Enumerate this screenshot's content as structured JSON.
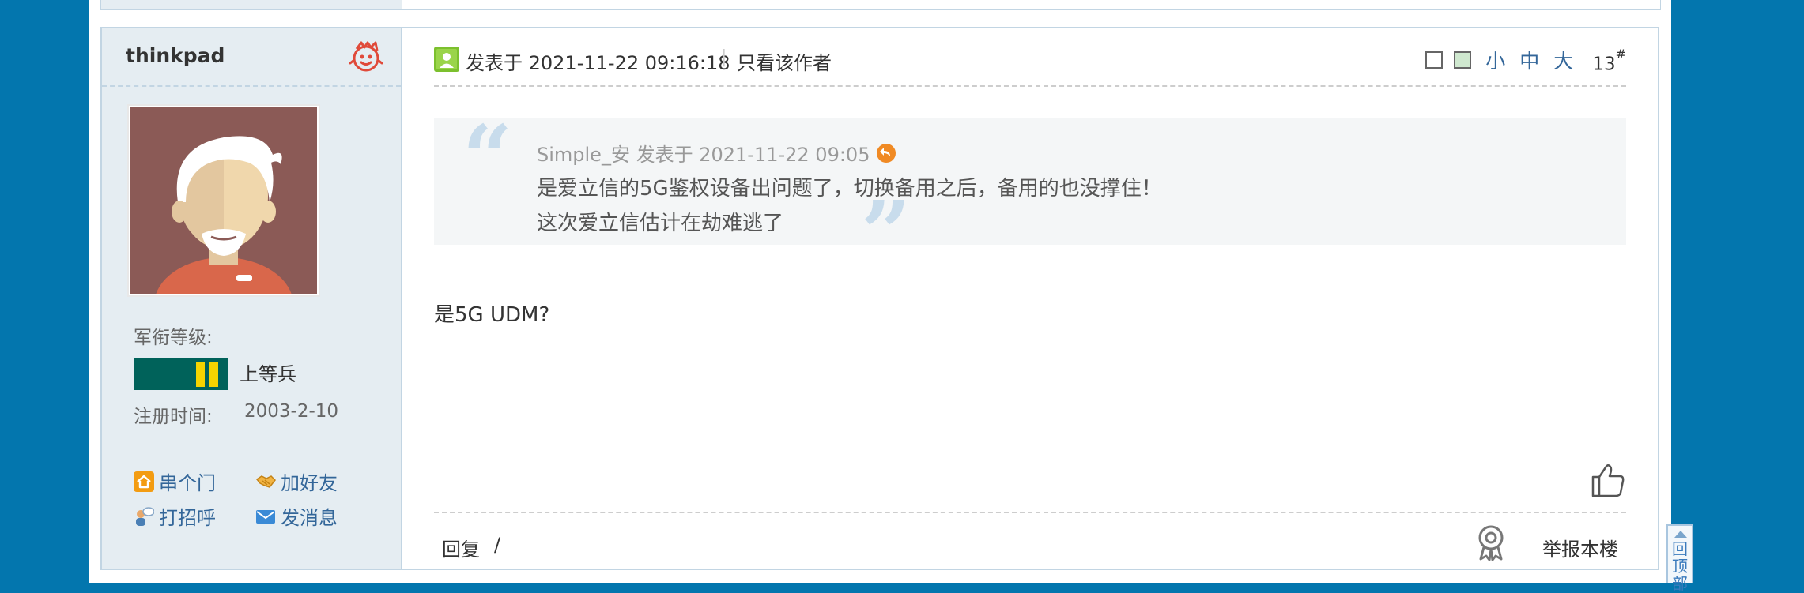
{
  "author": {
    "username": "thinkpad",
    "rank_label": "军衔等级:",
    "rank_name": "上等兵",
    "reg_label": "注册时间:",
    "reg_value": "2003-2-10",
    "links": [
      {
        "label": "串个门",
        "icon": "home-icon"
      },
      {
        "label": "加好友",
        "icon": "handshake-icon"
      },
      {
        "label": "打招呼",
        "icon": "greet-icon"
      },
      {
        "label": "发消息",
        "icon": "mail-icon"
      }
    ]
  },
  "post": {
    "time": "发表于 2021-11-22 09:16:18",
    "pipe": "|",
    "only_author": "只看该作者",
    "font_small": "小",
    "font_medium": "中",
    "font_large": "大",
    "floor": "13",
    "floor_mark": "#",
    "quote": {
      "meta": "Simple_安 发表于 2021-11-22 09:05",
      "line1": "是爱立信的5G鉴权设备出问题了，切换备用之后，备用的也没撑住！",
      "line2": "这次爱立信估计在劫难逃了",
      "open_mark": "“",
      "close_mark": "”"
    },
    "body": "是5G UDM?",
    "reply": "回复",
    "slash": "/",
    "report": "举报本楼"
  },
  "totop": "回顶部",
  "colors": {
    "page_bg": "#0376ae",
    "sidebar_bg": "#e5edf2",
    "border": "#c2d5e3",
    "link": "#336699",
    "rank_green": "#00625a",
    "rank_yellow": "#f5d400"
  }
}
